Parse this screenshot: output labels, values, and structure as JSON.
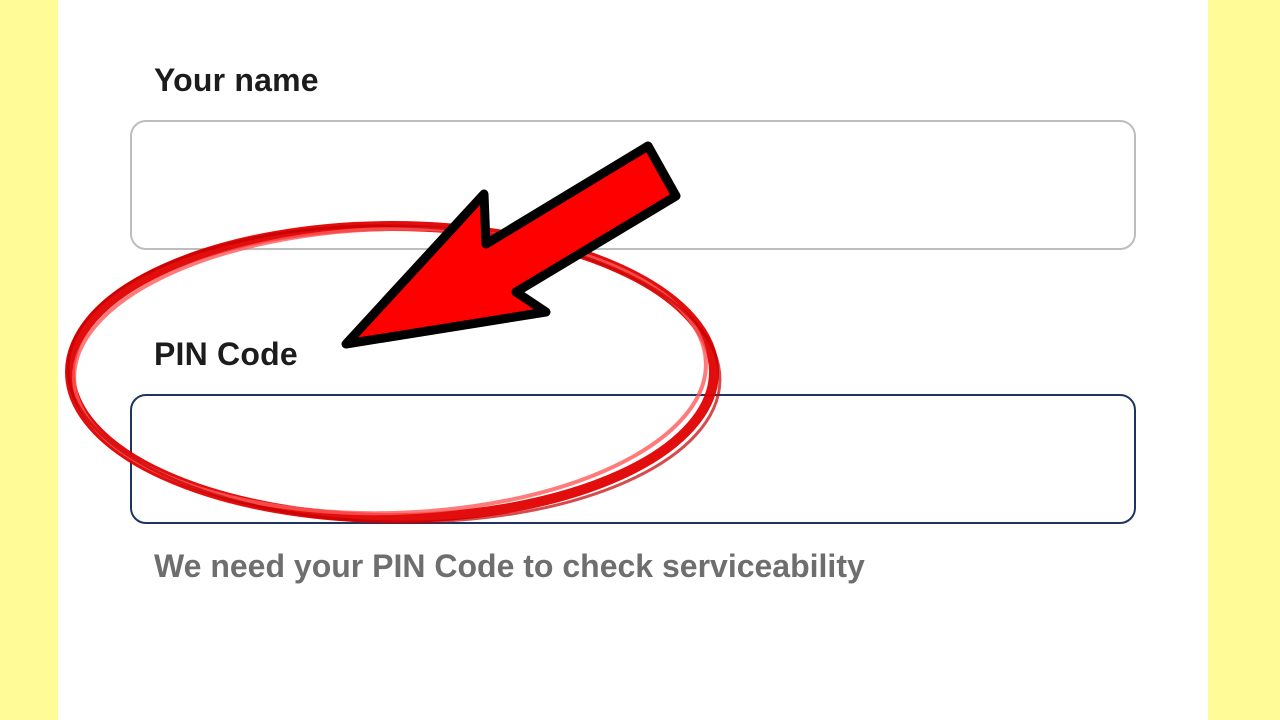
{
  "form": {
    "name_label": "Your name",
    "name_value": "",
    "pin_label": "PIN Code",
    "pin_value": "",
    "pin_helper": "We need your PIN Code to check serviceability"
  },
  "annotation": {
    "arrow_color": "#ff0000",
    "arrow_outline": "#000000",
    "circle_color": "#e00000"
  },
  "colors": {
    "side_background": "#fffb96",
    "panel_background": "#ffffff",
    "pin_border": "#1f3560",
    "name_border": "#bdbdbd"
  }
}
